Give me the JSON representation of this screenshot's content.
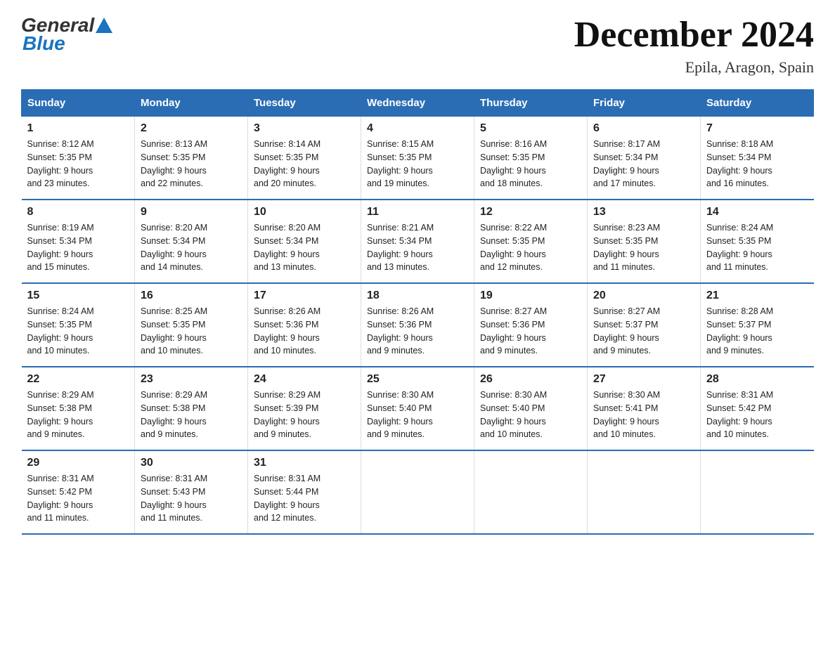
{
  "logo": {
    "text_general": "General",
    "text_blue": "Blue"
  },
  "title": "December 2024",
  "subtitle": "Epila, Aragon, Spain",
  "days_of_week": [
    "Sunday",
    "Monday",
    "Tuesday",
    "Wednesday",
    "Thursday",
    "Friday",
    "Saturday"
  ],
  "weeks": [
    [
      {
        "day": "1",
        "sunrise": "8:12 AM",
        "sunset": "5:35 PM",
        "daylight": "9 hours and 23 minutes."
      },
      {
        "day": "2",
        "sunrise": "8:13 AM",
        "sunset": "5:35 PM",
        "daylight": "9 hours and 22 minutes."
      },
      {
        "day": "3",
        "sunrise": "8:14 AM",
        "sunset": "5:35 PM",
        "daylight": "9 hours and 20 minutes."
      },
      {
        "day": "4",
        "sunrise": "8:15 AM",
        "sunset": "5:35 PM",
        "daylight": "9 hours and 19 minutes."
      },
      {
        "day": "5",
        "sunrise": "8:16 AM",
        "sunset": "5:35 PM",
        "daylight": "9 hours and 18 minutes."
      },
      {
        "day": "6",
        "sunrise": "8:17 AM",
        "sunset": "5:34 PM",
        "daylight": "9 hours and 17 minutes."
      },
      {
        "day": "7",
        "sunrise": "8:18 AM",
        "sunset": "5:34 PM",
        "daylight": "9 hours and 16 minutes."
      }
    ],
    [
      {
        "day": "8",
        "sunrise": "8:19 AM",
        "sunset": "5:34 PM",
        "daylight": "9 hours and 15 minutes."
      },
      {
        "day": "9",
        "sunrise": "8:20 AM",
        "sunset": "5:34 PM",
        "daylight": "9 hours and 14 minutes."
      },
      {
        "day": "10",
        "sunrise": "8:20 AM",
        "sunset": "5:34 PM",
        "daylight": "9 hours and 13 minutes."
      },
      {
        "day": "11",
        "sunrise": "8:21 AM",
        "sunset": "5:34 PM",
        "daylight": "9 hours and 13 minutes."
      },
      {
        "day": "12",
        "sunrise": "8:22 AM",
        "sunset": "5:35 PM",
        "daylight": "9 hours and 12 minutes."
      },
      {
        "day": "13",
        "sunrise": "8:23 AM",
        "sunset": "5:35 PM",
        "daylight": "9 hours and 11 minutes."
      },
      {
        "day": "14",
        "sunrise": "8:24 AM",
        "sunset": "5:35 PM",
        "daylight": "9 hours and 11 minutes."
      }
    ],
    [
      {
        "day": "15",
        "sunrise": "8:24 AM",
        "sunset": "5:35 PM",
        "daylight": "9 hours and 10 minutes."
      },
      {
        "day": "16",
        "sunrise": "8:25 AM",
        "sunset": "5:35 PM",
        "daylight": "9 hours and 10 minutes."
      },
      {
        "day": "17",
        "sunrise": "8:26 AM",
        "sunset": "5:36 PM",
        "daylight": "9 hours and 10 minutes."
      },
      {
        "day": "18",
        "sunrise": "8:26 AM",
        "sunset": "5:36 PM",
        "daylight": "9 hours and 9 minutes."
      },
      {
        "day": "19",
        "sunrise": "8:27 AM",
        "sunset": "5:36 PM",
        "daylight": "9 hours and 9 minutes."
      },
      {
        "day": "20",
        "sunrise": "8:27 AM",
        "sunset": "5:37 PM",
        "daylight": "9 hours and 9 minutes."
      },
      {
        "day": "21",
        "sunrise": "8:28 AM",
        "sunset": "5:37 PM",
        "daylight": "9 hours and 9 minutes."
      }
    ],
    [
      {
        "day": "22",
        "sunrise": "8:29 AM",
        "sunset": "5:38 PM",
        "daylight": "9 hours and 9 minutes."
      },
      {
        "day": "23",
        "sunrise": "8:29 AM",
        "sunset": "5:38 PM",
        "daylight": "9 hours and 9 minutes."
      },
      {
        "day": "24",
        "sunrise": "8:29 AM",
        "sunset": "5:39 PM",
        "daylight": "9 hours and 9 minutes."
      },
      {
        "day": "25",
        "sunrise": "8:30 AM",
        "sunset": "5:40 PM",
        "daylight": "9 hours and 9 minutes."
      },
      {
        "day": "26",
        "sunrise": "8:30 AM",
        "sunset": "5:40 PM",
        "daylight": "9 hours and 10 minutes."
      },
      {
        "day": "27",
        "sunrise": "8:30 AM",
        "sunset": "5:41 PM",
        "daylight": "9 hours and 10 minutes."
      },
      {
        "day": "28",
        "sunrise": "8:31 AM",
        "sunset": "5:42 PM",
        "daylight": "9 hours and 10 minutes."
      }
    ],
    [
      {
        "day": "29",
        "sunrise": "8:31 AM",
        "sunset": "5:42 PM",
        "daylight": "9 hours and 11 minutes."
      },
      {
        "day": "30",
        "sunrise": "8:31 AM",
        "sunset": "5:43 PM",
        "daylight": "9 hours and 11 minutes."
      },
      {
        "day": "31",
        "sunrise": "8:31 AM",
        "sunset": "5:44 PM",
        "daylight": "9 hours and 12 minutes."
      },
      null,
      null,
      null,
      null
    ]
  ],
  "labels": {
    "sunrise": "Sunrise:",
    "sunset": "Sunset:",
    "daylight": "Daylight:"
  }
}
